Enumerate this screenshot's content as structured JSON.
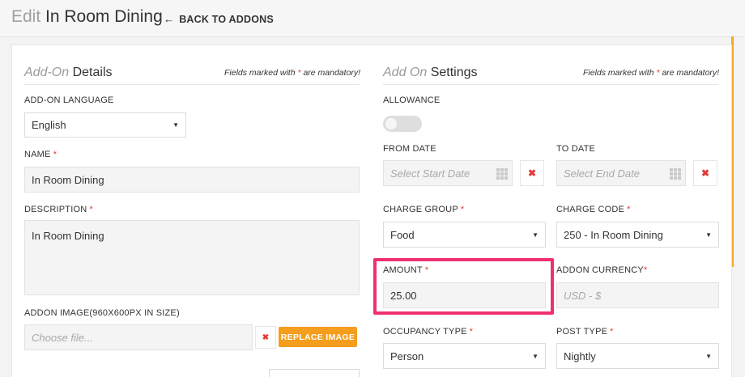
{
  "header": {
    "title_prefix": "Edit",
    "title": "In Room Dining",
    "back_label": "BACK TO ADDONS",
    "back_icon": "arrow-left-icon"
  },
  "left": {
    "heading_light": "Add-On",
    "heading_bold": "Details",
    "mandatory_before": "Fields marked with ",
    "mandatory_star": "*",
    "mandatory_after": " are mandatory!",
    "language_label": "ADD-ON LANGUAGE",
    "language_value": "English",
    "name_label": "NAME",
    "name_value": "In Room Dining",
    "description_label": "DESCRIPTION",
    "description_value": "In Room Dining",
    "image_label": "ADDON IMAGE(960X600PX IN SIZE)",
    "image_placeholder": "Choose file...",
    "replace_label": "REPLACE IMAGE",
    "remove_symbol": "✖"
  },
  "right": {
    "heading_light": "Add On",
    "heading_bold": "Settings",
    "mandatory_before": "Fields marked with ",
    "mandatory_star": "*",
    "mandatory_after": " are mandatory!",
    "allowance_label": "ALLOWANCE",
    "allowance_on": false,
    "from_date_label": "FROM DATE",
    "from_date_placeholder": "Select Start Date",
    "to_date_label": "TO DATE",
    "to_date_placeholder": "Select End Date",
    "clear_symbol": "✖",
    "charge_group_label": "CHARGE GROUP",
    "charge_group_value": "Food",
    "charge_code_label": "CHARGE CODE",
    "charge_code_value": "250 - In Room Dining",
    "amount_label": "AMOUNT",
    "amount_value": "25.00",
    "currency_label": "ADDON CURRENCY",
    "currency_placeholder": "USD - $",
    "occupancy_label": "OCCUPANCY TYPE",
    "occupancy_value": "Person",
    "post_type_label": "POST TYPE",
    "post_type_value": "Nightly"
  },
  "required_star": "*",
  "caret": "▼",
  "colors": {
    "accent": "#f59d1c",
    "required": "#e53935",
    "highlight": "#f0306e"
  }
}
